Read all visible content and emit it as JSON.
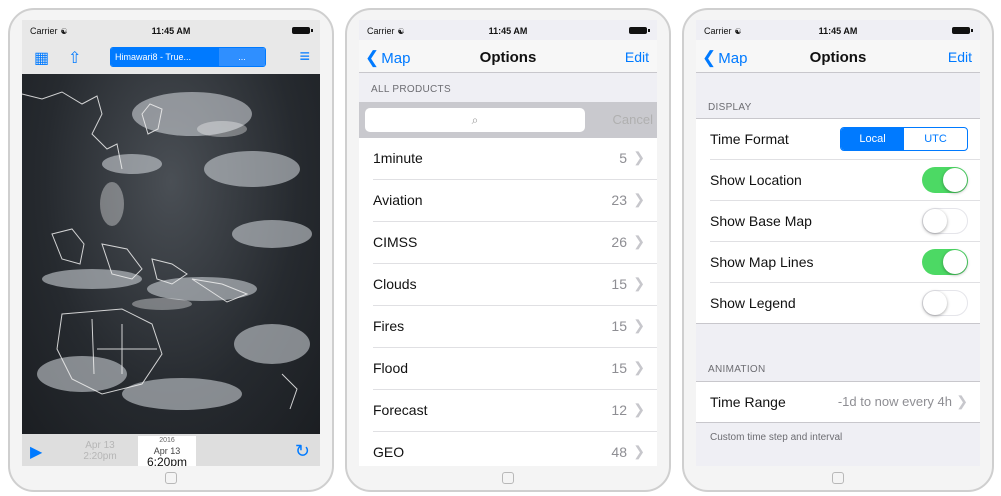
{
  "status_bar": {
    "carrier": "Carrier",
    "wifi_icon": "wifi-icon",
    "time": "11:45 AM"
  },
  "map_screen": {
    "product_label": "Himawari8 - True...",
    "more_label": "...",
    "animation": {
      "prev_date": "Apr 13",
      "prev_time": "2:20pm",
      "year": "2016",
      "date": "Apr 13",
      "time": "6:20pm"
    },
    "icons": [
      "layers-icon",
      "share-icon",
      "menu-icon",
      "play-icon",
      "refresh-icon"
    ]
  },
  "products_screen": {
    "back_label": "Map",
    "title": "Options",
    "edit_label": "Edit",
    "section_header": "ALL PRODUCTS",
    "search_icon": "⌕",
    "cancel_label": "Cancel",
    "items": [
      {
        "label": "1minute",
        "count": "5"
      },
      {
        "label": "Aviation",
        "count": "23"
      },
      {
        "label": "CIMSS",
        "count": "26"
      },
      {
        "label": "Clouds",
        "count": "15"
      },
      {
        "label": "Fires",
        "count": "15"
      },
      {
        "label": "Flood",
        "count": "15"
      },
      {
        "label": "Forecast",
        "count": "12"
      },
      {
        "label": "GEO",
        "count": "48"
      }
    ]
  },
  "settings_screen": {
    "back_label": "Map",
    "title": "Options",
    "edit_label": "Edit",
    "display_header": "DISPLAY",
    "time_format_label": "Time Format",
    "time_format_options": [
      "Local",
      "UTC"
    ],
    "time_format_selected": "Local",
    "toggles": [
      {
        "label": "Show Location",
        "on": true
      },
      {
        "label": "Show Base Map",
        "on": false
      },
      {
        "label": "Show Map Lines",
        "on": true
      },
      {
        "label": "Show Legend",
        "on": false
      }
    ],
    "animation_header": "ANIMATION",
    "time_range_label": "Time Range",
    "time_range_value": "-1d to now every 4h",
    "footer_note": "Custom time step and interval"
  },
  "colors": {
    "accent": "#007aff",
    "toggle_on": "#4cd964",
    "grouped_bg": "#efeff4"
  }
}
